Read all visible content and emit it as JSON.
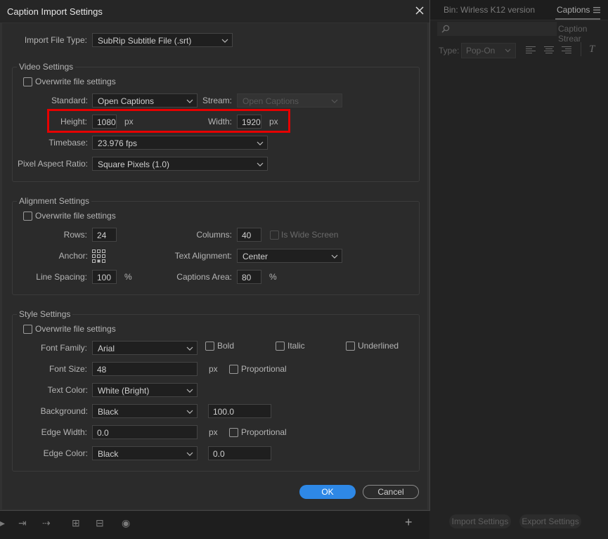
{
  "dialog": {
    "title": "Caption Import Settings",
    "close_glyph": "✕",
    "import_file_type_label": "Import File Type:",
    "import_file_type_value": "SubRip Subtitle File (.srt)",
    "ok_label": "OK",
    "cancel_label": "Cancel"
  },
  "video": {
    "title": "Video Settings",
    "overwrite_label": "Overwrite file settings",
    "standard_label": "Standard:",
    "standard_value": "Open Captions",
    "stream_label": "Stream:",
    "stream_value": "Open Captions",
    "height_label": "Height:",
    "height_value": "1080",
    "width_label": "Width:",
    "width_value": "1920",
    "px": "px",
    "timebase_label": "Timebase:",
    "timebase_value": "23.976 fps",
    "par_label": "Pixel Aspect Ratio:",
    "par_value": "Square Pixels (1.0)"
  },
  "alignment": {
    "title": "Alignment Settings",
    "overwrite_label": "Overwrite file settings",
    "rows_label": "Rows:",
    "rows_value": "24",
    "columns_label": "Columns:",
    "columns_value": "40",
    "wide_label": "Is Wide Screen",
    "anchor_label": "Anchor:",
    "text_alignment_label": "Text Alignment:",
    "text_alignment_value": "Center",
    "line_spacing_label": "Line Spacing:",
    "line_spacing_value": "100",
    "captions_area_label": "Captions Area:",
    "captions_area_value": "80",
    "percent": "%"
  },
  "style": {
    "title": "Style Settings",
    "overwrite_label": "Overwrite file settings",
    "font_family_label": "Font Family:",
    "font_family_value": "Arial",
    "bold_label": "Bold",
    "italic_label": "Italic",
    "underlined_label": "Underlined",
    "font_size_label": "Font Size:",
    "font_size_value": "48",
    "px": "px",
    "proportional_label": "Proportional",
    "text_color_label": "Text Color:",
    "text_color_value": "White (Bright)",
    "background_label": "Background:",
    "background_value": "Black",
    "background_opacity": "100.0",
    "edge_width_label": "Edge Width:",
    "edge_width_value": "0.0",
    "edge_color_label": "Edge Color:",
    "edge_color_value": "Black",
    "edge_color_opacity": "0.0"
  },
  "background_panel": {
    "bin_tab": "Bin: Wirless K12 version",
    "captions_tab": "Captions",
    "caption_stream_placeholder": "Caption Strear",
    "type_label": "Type:",
    "type_value": "Pop-On",
    "italic_glyph": "T",
    "import_settings": "Import Settings",
    "export_settings": "Export Settings",
    "add_glyph": "+"
  },
  "colors": {
    "accent": "#2e88e6",
    "highlight": "#e60000"
  }
}
